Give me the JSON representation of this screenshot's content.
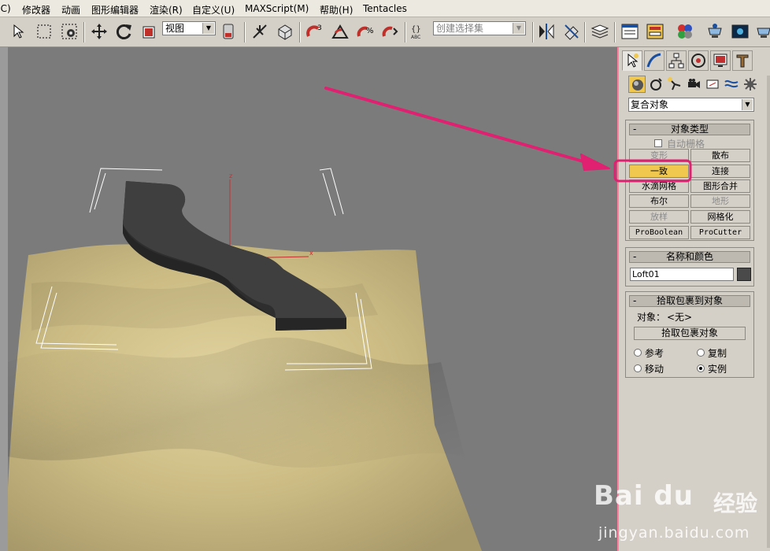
{
  "menubar": {
    "items": [
      "(C)",
      "修改器",
      "动画",
      "图形编辑器",
      "渲染(R)",
      "自定义(U)",
      "MAXScript(M)",
      "帮助(H)",
      "Tentacles"
    ]
  },
  "toolbar": {
    "view_combo": "视图",
    "selection_set_placeholder": "创建选择集",
    "snap_angle_label": "3",
    "icons": [
      "select-region-icon",
      "select-by-name-icon",
      "selection-filter-icon",
      "move-icon",
      "rotate-icon",
      "scale-icon",
      "view-dropdown",
      "mirror-icon",
      "link-icon",
      "bind-icon",
      "snap-toggle-icon",
      "angle-snap-icon",
      "percent-snap-icon",
      "spinner-snap-icon",
      "named-selection-icon",
      "align-icon",
      "layer-icon",
      "curve-editor-icon",
      "schematic-icon",
      "material-editor-icon",
      "render-setup-icon",
      "render-frame-icon",
      "quick-render-icon"
    ]
  },
  "command_panel": {
    "tabs": [
      "create-tab",
      "modify-tab",
      "hierarchy-tab",
      "motion-tab",
      "display-tab",
      "utilities-tab"
    ],
    "sub_icons": [
      "geometry-icon",
      "shapes-icon",
      "lights-icon",
      "cameras-icon",
      "helpers-icon",
      "space-warps-icon",
      "systems-icon"
    ],
    "category_dropdown": "复合对象",
    "object_type": {
      "title": "对象类型",
      "collapse": "-",
      "autogrid_label": "自动栅格",
      "buttons": [
        {
          "label": "变形",
          "enabled": false
        },
        {
          "label": "散布",
          "enabled": true
        },
        {
          "label": "一致",
          "enabled": true,
          "active": true
        },
        {
          "label": "连接",
          "enabled": true
        },
        {
          "label": "水滴网格",
          "enabled": true
        },
        {
          "label": "图形合并",
          "enabled": true
        },
        {
          "label": "布尔",
          "enabled": true
        },
        {
          "label": "地形",
          "enabled": false
        },
        {
          "label": "放样",
          "enabled": false
        },
        {
          "label": "网格化",
          "enabled": true
        },
        {
          "label": "ProBoolean",
          "enabled": true
        },
        {
          "label": "ProCutter",
          "enabled": true
        }
      ]
    },
    "name_color": {
      "title": "名称和颜色",
      "collapse": "-",
      "name_value": "Loft01",
      "color": "#4a4a4a"
    },
    "pick_wrap": {
      "title": "拾取包裹到对象",
      "collapse": "-",
      "object_label": "对象：",
      "object_value": "<无>",
      "pick_button": "拾取包裹对象",
      "radios": [
        {
          "label": "参考",
          "checked": false
        },
        {
          "label": "复制",
          "checked": false
        },
        {
          "label": "移动",
          "checked": false
        },
        {
          "label": "实例",
          "checked": true
        }
      ]
    }
  },
  "viewport": {
    "background": "#7b7b7b",
    "terrain_color": "#d8c890",
    "object_color": "#3e3e3e",
    "axis_labels": [
      "z",
      "x"
    ]
  },
  "annotation": {
    "arrow_color": "#e02070",
    "highlight_color": "#e02070"
  },
  "watermark": {
    "brand": "Bai du",
    "brand_cn": "经验",
    "url": "jingyan.baidu.com"
  }
}
